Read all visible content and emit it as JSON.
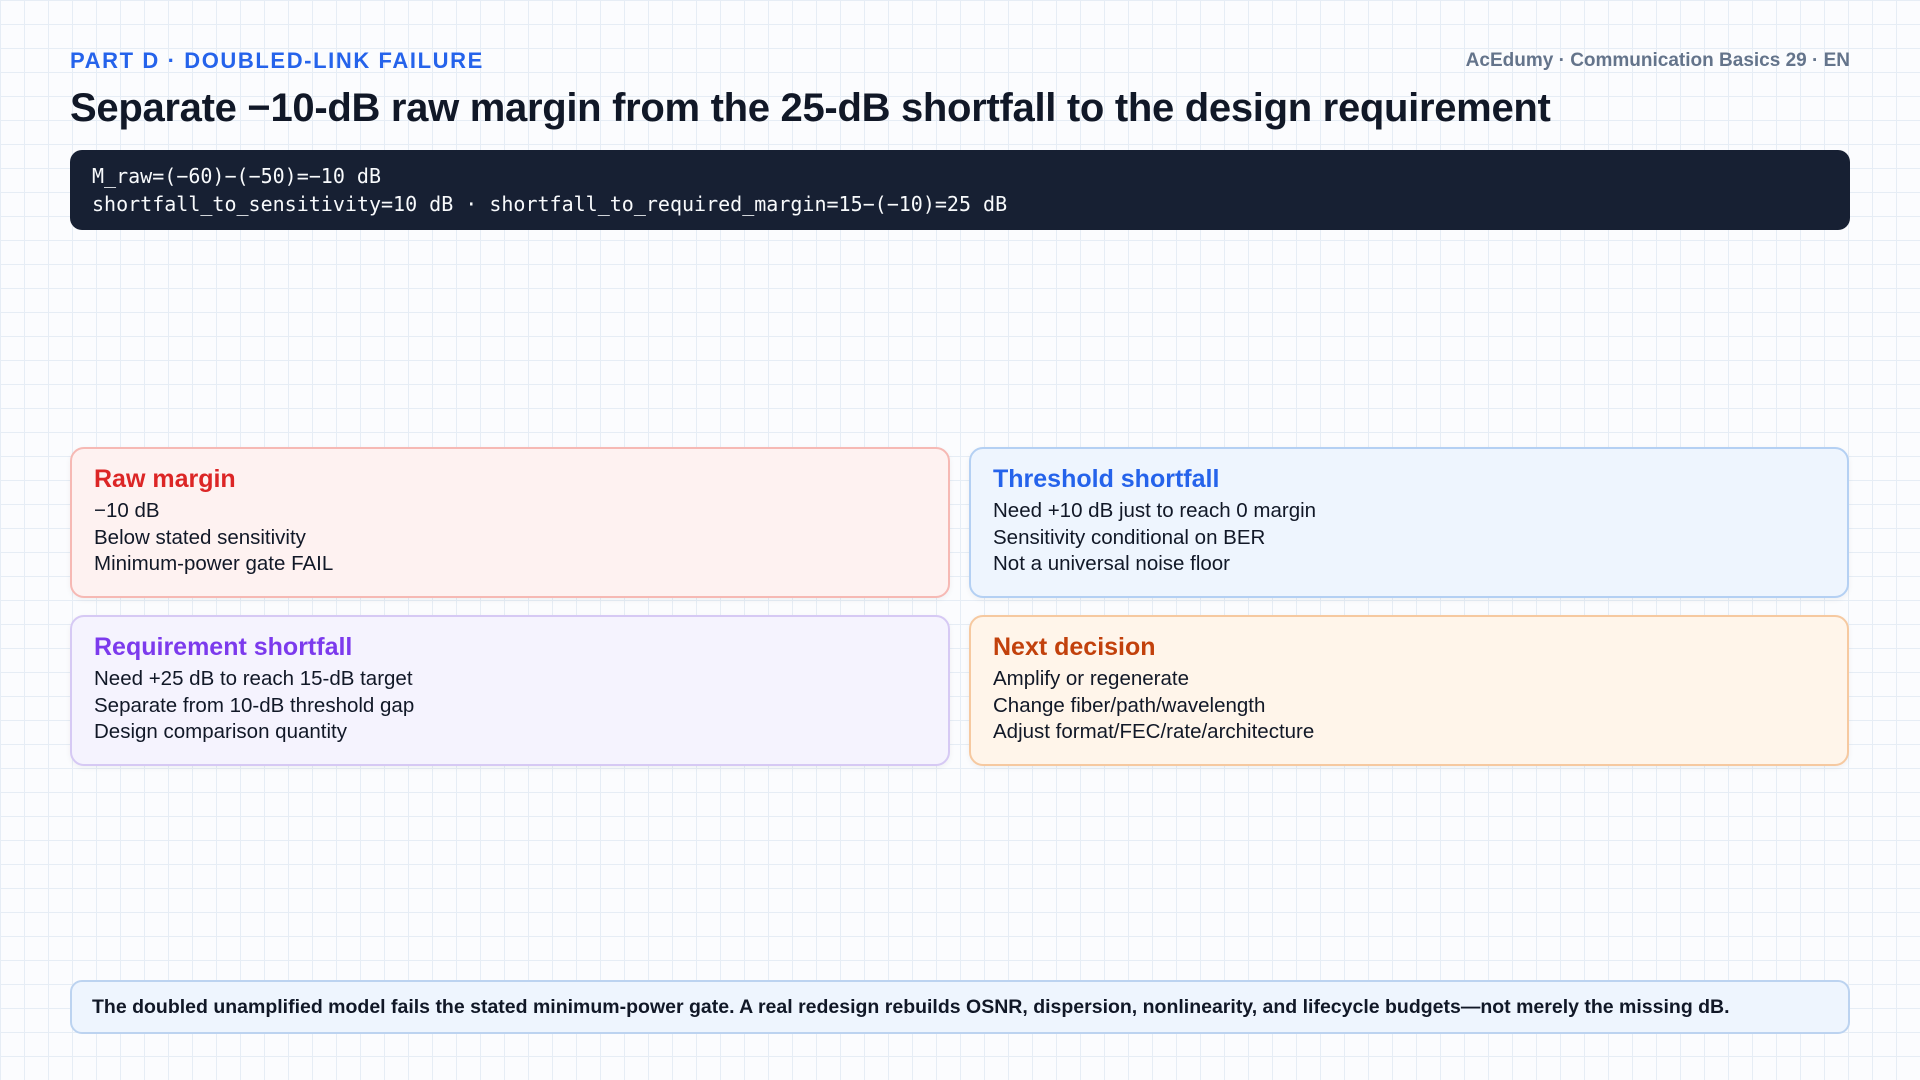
{
  "header": {
    "kicker": "PART D · DOUBLED-LINK FAILURE",
    "brand": "AcEdumy · Communication Basics 29 · EN",
    "title": "Separate −10-dB raw margin from the 25-dB shortfall to the design requirement"
  },
  "code": {
    "lines": [
      "M_raw=(−60)−(−50)=−10 dB",
      "shortfall_to_sensitivity=10 dB · shortfall_to_required_margin=15−(−10)=25 dB"
    ]
  },
  "cards": [
    {
      "title": "Raw margin",
      "lines": [
        "−10 dB",
        "Below stated sensitivity",
        "Minimum-power gate FAIL"
      ],
      "accent": "#dc2626"
    },
    {
      "title": "Threshold shortfall",
      "lines": [
        "Need +10 dB just to reach 0 margin",
        "Sensitivity conditional on BER",
        "Not a universal noise floor"
      ],
      "accent": "#2563eb"
    },
    {
      "title": "Requirement shortfall",
      "lines": [
        "Need +25 dB to reach 15-dB target",
        "Separate from 10-dB threshold gap",
        "Design comparison quantity"
      ],
      "accent": "#7c3aed"
    },
    {
      "title": "Next decision",
      "lines": [
        "Amplify or regenerate",
        "Change fiber/path/wavelength",
        "Adjust format/FEC/rate/architecture"
      ],
      "accent": "#c2410c"
    }
  ],
  "footer": {
    "note": "The doubled unamplified model fails the stated minimum-power gate. A real redesign rebuilds OSNR, dispersion, nonlinearity, and lifecycle budgets—not merely the missing dB."
  }
}
